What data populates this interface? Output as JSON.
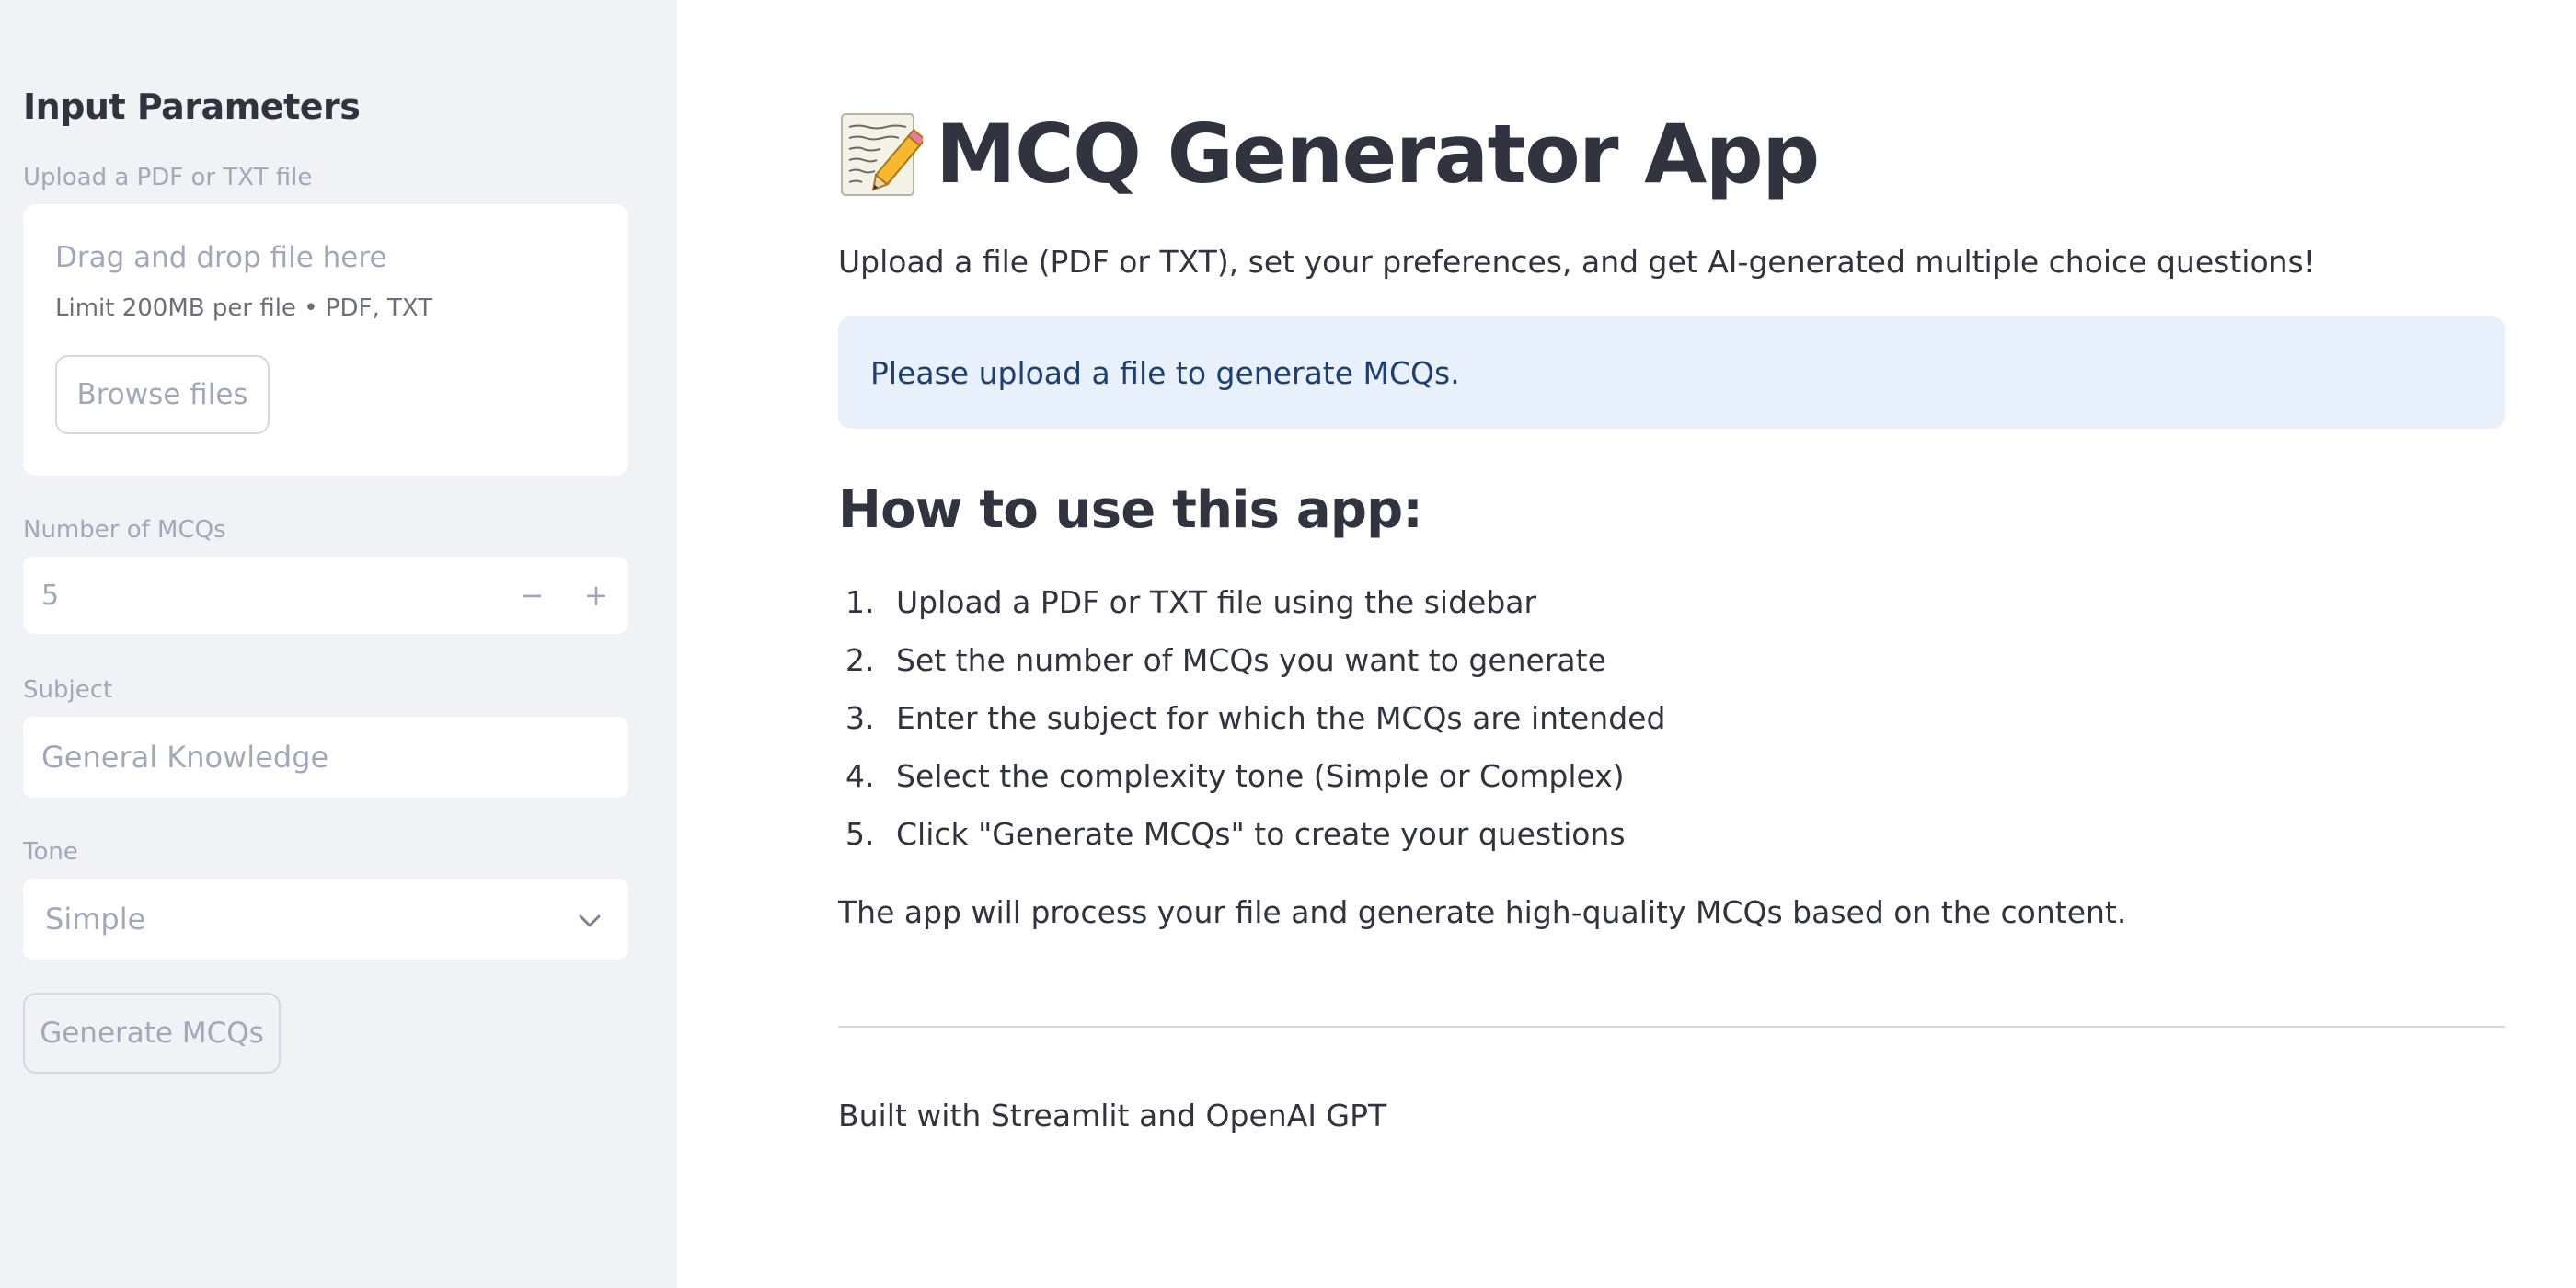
{
  "sidebar": {
    "title": "Input Parameters",
    "upload": {
      "label": "Upload a PDF or TXT file",
      "drop_text": "Drag and drop file here",
      "limit_text": "Limit 200MB per file • PDF, TXT",
      "browse_label": "Browse files"
    },
    "num_mcqs": {
      "label": "Number of MCQs",
      "value": "5",
      "minus": "−",
      "plus": "+"
    },
    "subject": {
      "label": "Subject",
      "placeholder": "General Knowledge"
    },
    "tone": {
      "label": "Tone",
      "selected": "Simple"
    },
    "generate_label": "Generate MCQs"
  },
  "main": {
    "title": "MCQ Generator App",
    "title_icon": "memo-icon",
    "intro": "Upload a file (PDF or TXT), set your preferences, and get AI-generated multiple choice questions!",
    "info": "Please upload a file to generate MCQs.",
    "howto_heading": "How to use this app:",
    "steps": [
      {
        "num": "1.",
        "text": "Upload a PDF or TXT file using the sidebar"
      },
      {
        "num": "2.",
        "text": "Set the number of MCQs you want to generate"
      },
      {
        "num": "3.",
        "text": "Enter the subject for which the MCQs are intended"
      },
      {
        "num": "4.",
        "text": "Select the complexity tone (Simple or Complex)"
      },
      {
        "num": "5.",
        "text": "Click \"Generate MCQs\" to create your questions"
      }
    ],
    "outro": "The app will process your file and generate high-quality MCQs based on the content.",
    "footer": "Built with Streamlit and OpenAI GPT"
  },
  "colors": {
    "sidebar_bg": "#f0f2f6",
    "info_bg": "#e8f0fb",
    "info_text": "#1e3f73",
    "text": "#31333f",
    "muted": "#a3a8b8"
  }
}
